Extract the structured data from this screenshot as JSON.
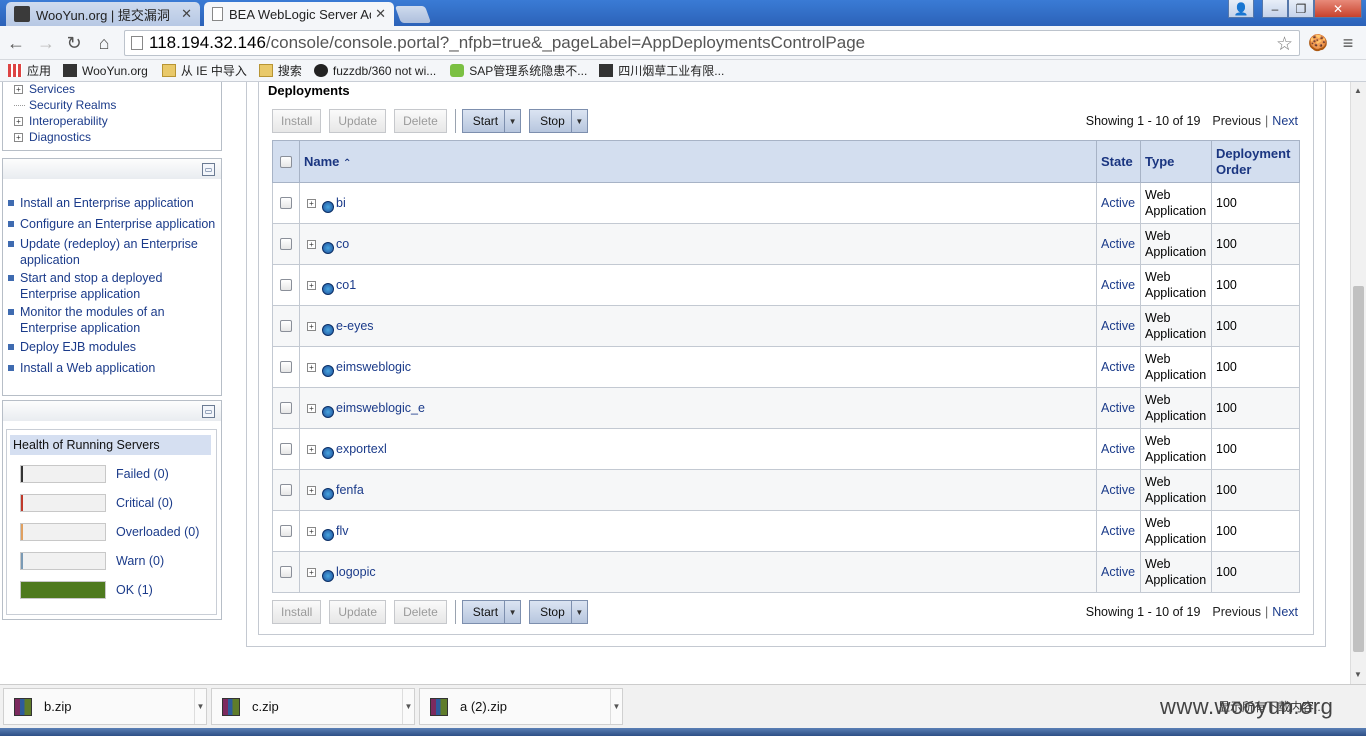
{
  "browser": {
    "tabs": [
      {
        "title": "WooYun.org | 提交漏洞",
        "active": false
      },
      {
        "title": "BEA WebLogic Server Ad",
        "active": true
      }
    ],
    "url_host": "118.194.32.146",
    "url_path": "/console/console.portal?_nfpb=true&_pageLabel=AppDeploymentsControlPage",
    "bookmarks": [
      "应用",
      "WooYun.org",
      "从 IE 中导入",
      "搜索",
      "fuzzdb/360 not wi...",
      "SAP管理系统隐患不...",
      "四川烟草工业有限..."
    ]
  },
  "sidebar": {
    "tree": [
      {
        "label": "Services",
        "expandable": true
      },
      {
        "label": "Security Realms",
        "expandable": false
      },
      {
        "label": "Interoperability",
        "expandable": true
      },
      {
        "label": "Diagnostics",
        "expandable": true
      }
    ],
    "howto": [
      "Install an Enterprise application",
      "Configure an Enterprise application",
      "Update (redeploy) an Enterprise application",
      "Start and stop a deployed Enterprise application",
      "Monitor the modules of an Enterprise application",
      "Deploy EJB modules",
      "Install a Web application"
    ],
    "health": {
      "title": "Health of Running Servers",
      "rows": [
        {
          "label": "Failed (0)",
          "color": "#333333",
          "fill": 0
        },
        {
          "label": "Critical (0)",
          "color": "#c0392b",
          "fill": 0
        },
        {
          "label": "Overloaded (0)",
          "color": "#e0a060",
          "fill": 0
        },
        {
          "label": "Warn (0)",
          "color": "#7a9ab5",
          "fill": 0
        },
        {
          "label": "OK (1)",
          "color": "#4e7a1e",
          "fill": 1
        }
      ]
    }
  },
  "main": {
    "title": "Deployments",
    "buttons": {
      "install": "Install",
      "update": "Update",
      "delete": "Delete",
      "start": "Start",
      "stop": "Stop"
    },
    "pager": {
      "showing": "Showing 1 - 10 of 19",
      "previous": "Previous",
      "separator": "|",
      "next": "Next"
    },
    "columns": {
      "name": "Name",
      "state": "State",
      "type": "Type",
      "order": "Deployment Order"
    },
    "rows": [
      {
        "name": "bi",
        "state": "Active",
        "type": "Web Application",
        "order": "100"
      },
      {
        "name": "co",
        "state": "Active",
        "type": "Web Application",
        "order": "100"
      },
      {
        "name": "co1",
        "state": "Active",
        "type": "Web Application",
        "order": "100"
      },
      {
        "name": "e-eyes",
        "state": "Active",
        "type": "Web Application",
        "order": "100"
      },
      {
        "name": "eimsweblogic",
        "state": "Active",
        "type": "Web Application",
        "order": "100"
      },
      {
        "name": "eimsweblogic_e",
        "state": "Active",
        "type": "Web Application",
        "order": "100"
      },
      {
        "name": "exportexl",
        "state": "Active",
        "type": "Web Application",
        "order": "100"
      },
      {
        "name": "fenfa",
        "state": "Active",
        "type": "Web Application",
        "order": "100"
      },
      {
        "name": "flv",
        "state": "Active",
        "type": "Web Application",
        "order": "100"
      },
      {
        "name": "logopic",
        "state": "Active",
        "type": "Web Application",
        "order": "100"
      }
    ]
  },
  "downloads": {
    "items": [
      "b.zip",
      "c.zip",
      "a (2).zip"
    ],
    "show_all": "显示所有下载内容...",
    "watermark": "www.wooyun.org"
  }
}
